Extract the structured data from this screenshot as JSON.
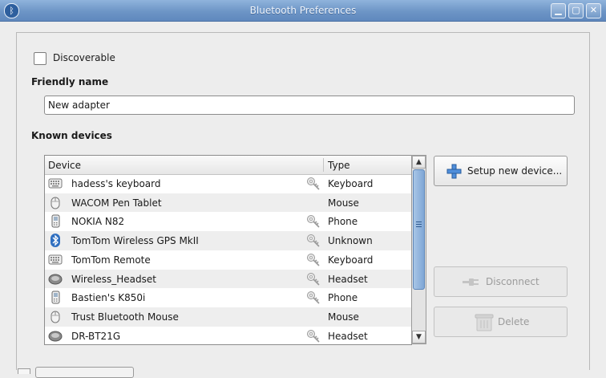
{
  "window": {
    "title": "Bluetooth Preferences",
    "icon": "bluetooth-icon",
    "controls": [
      "minimize-icon",
      "maximize-icon",
      "close-icon"
    ]
  },
  "discoverable": {
    "label": "Discoverable",
    "checked": false
  },
  "friendly_name": {
    "heading": "Friendly name",
    "value": "New adapter"
  },
  "known_devices": {
    "heading": "Known devices",
    "columns": [
      "Device",
      "Type"
    ],
    "rows": [
      {
        "icon": "keyboard-icon",
        "name": "hadess's keyboard",
        "paired": true,
        "type": "Keyboard"
      },
      {
        "icon": "mouse-icon",
        "name": "WACOM Pen Tablet",
        "paired": false,
        "type": "Mouse"
      },
      {
        "icon": "phone-icon",
        "name": "NOKIA N82",
        "paired": true,
        "type": "Phone"
      },
      {
        "icon": "bluetooth-icon",
        "name": "TomTom Wireless GPS MkII",
        "paired": true,
        "type": "Unknown"
      },
      {
        "icon": "keyboard-icon",
        "name": "TomTom Remote",
        "paired": true,
        "type": "Keyboard"
      },
      {
        "icon": "headset-icon",
        "name": "Wireless_Headset",
        "paired": true,
        "type": "Headset"
      },
      {
        "icon": "phone-icon",
        "name": "Bastien's K850i",
        "paired": true,
        "type": "Phone"
      },
      {
        "icon": "mouse-icon",
        "name": "Trust Bluetooth Mouse",
        "paired": false,
        "type": "Mouse"
      },
      {
        "icon": "headset-icon",
        "name": "DR-BT21G",
        "paired": true,
        "type": "Headset"
      }
    ]
  },
  "buttons": {
    "setup": {
      "label": "Setup new device...",
      "icon": "plus-icon",
      "enabled": true
    },
    "disconnect": {
      "label": "Disconnect",
      "icon": "plug-icon",
      "enabled": false
    },
    "delete": {
      "label": "Delete",
      "icon": "trash-icon",
      "enabled": false
    }
  },
  "colors": {
    "titlebar": "#6d95c6",
    "accent": "#2f6fc0"
  }
}
